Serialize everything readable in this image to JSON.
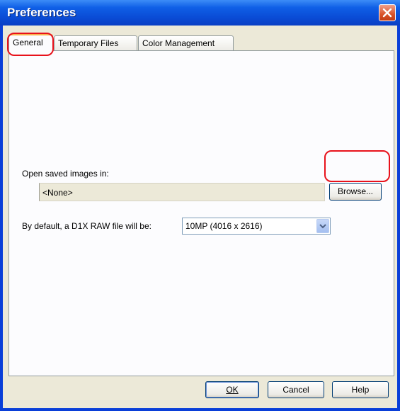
{
  "window": {
    "title": "Preferences",
    "close_label": "Close"
  },
  "tabs": [
    {
      "label": "General",
      "active": true
    },
    {
      "label": "Temporary Files",
      "active": false
    },
    {
      "label": "Color Management",
      "active": false
    }
  ],
  "general": {
    "open_saved_label": "Open saved images in:",
    "open_saved_value": "<None>",
    "browse_label": "Browse...",
    "raw_default_label": "By default, a D1X RAW file will be:",
    "raw_default_value": "10MP (4016 x 2616)"
  },
  "footer": {
    "ok_label": "OK",
    "cancel_label": "Cancel",
    "help_label": "Help"
  },
  "colors": {
    "titlebar": "#0a4bd5",
    "dialog_face": "#ece9d8",
    "annotation": "#e8121b"
  }
}
